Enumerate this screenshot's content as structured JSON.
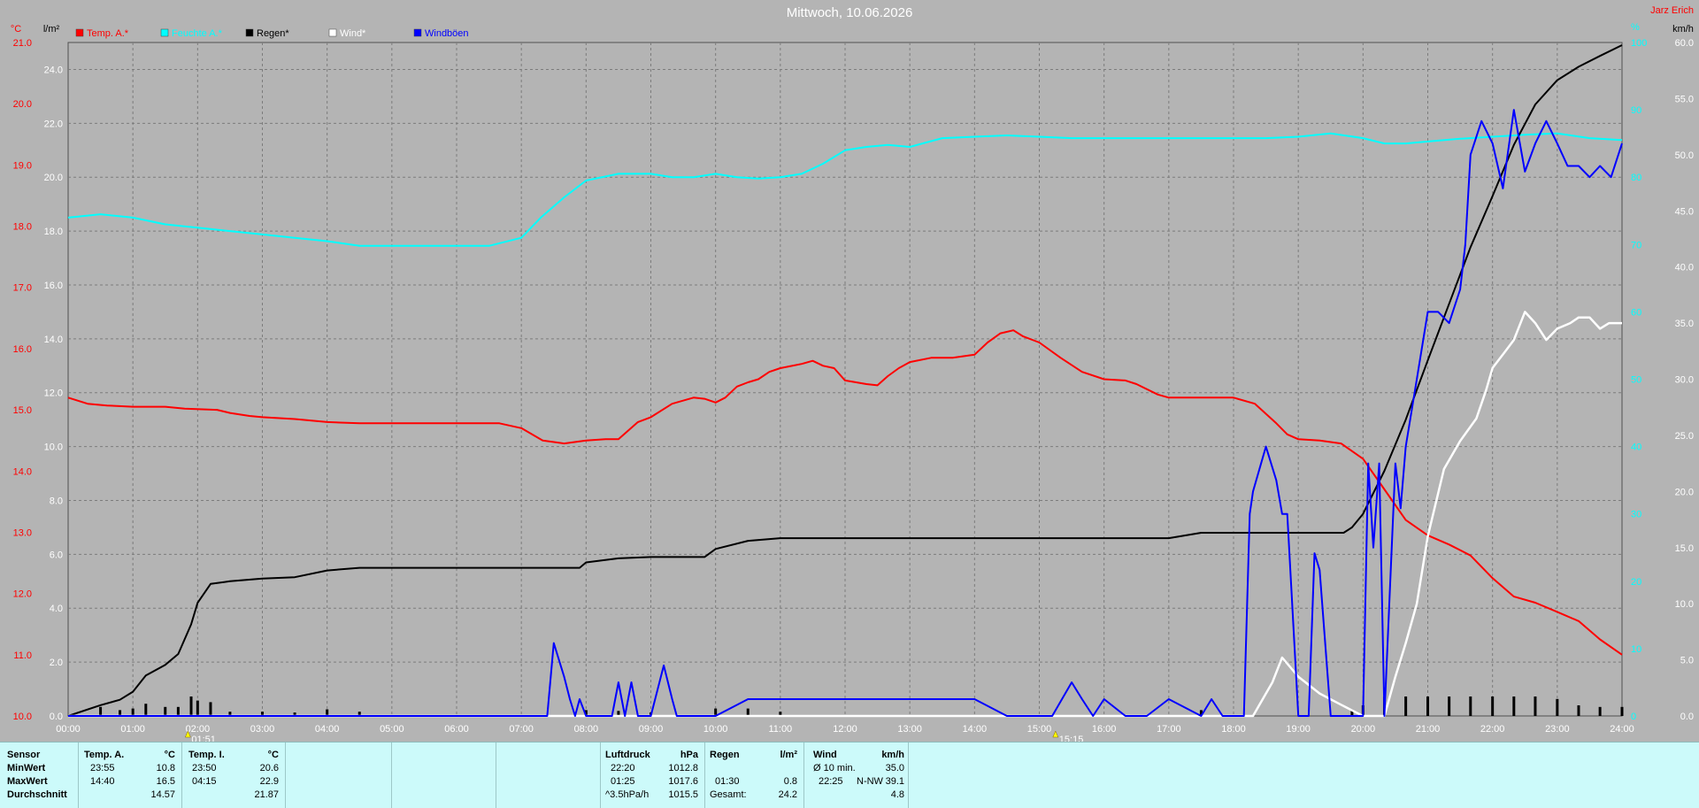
{
  "title": "Mittwoch, 10.06.2026",
  "author": "Jarz Erich",
  "units": {
    "left_outer": "°C",
    "left_inner": "l/m²",
    "right_inner": "%",
    "right_outer": "km/h"
  },
  "legend": [
    {
      "label": "Temp. A.*",
      "color": "#ff0000"
    },
    {
      "label": "Feuchte A.*",
      "color": "#00ffff"
    },
    {
      "label": "Regen*",
      "color": "#000000"
    },
    {
      "label": "Wind*",
      "color": "#ffffff"
    },
    {
      "label": "Windböen",
      "color": "#0000ff"
    }
  ],
  "markers": [
    {
      "time": "01:51",
      "hour": 1.85
    },
    {
      "time": "15:15",
      "hour": 15.25
    }
  ],
  "colors": {
    "background": "#b4b4b4",
    "grid": "#7c7c7c",
    "temp": "#ff0000",
    "humidity": "#00ffff",
    "rain": "#000000",
    "wind": "#ffffff",
    "gusts": "#0000ff",
    "table": "#ccfafa"
  },
  "chart_data": {
    "type": "line",
    "title": "Mittwoch, 10.06.2026",
    "x_ticks": [
      "00:00",
      "01:00",
      "02:00",
      "03:00",
      "04:00",
      "05:00",
      "06:00",
      "07:00",
      "08:00",
      "09:00",
      "10:00",
      "11:00",
      "12:00",
      "13:00",
      "14:00",
      "15:00",
      "16:00",
      "17:00",
      "18:00",
      "19:00",
      "20:00",
      "21:00",
      "22:00",
      "23:00",
      "24:00"
    ],
    "xlim": [
      0,
      24
    ],
    "axes": {
      "temp_c": {
        "ylim": [
          10,
          21
        ],
        "ticks": [
          "10.0",
          "11.0",
          "12.0",
          "13.0",
          "14.0",
          "15.0",
          "16.0",
          "17.0",
          "18.0",
          "19.0",
          "20.0",
          "21.0"
        ]
      },
      "rain_lm2": {
        "ylim": [
          0,
          25
        ],
        "ticks": [
          "0.0",
          "2.0",
          "4.0",
          "6.0",
          "8.0",
          "10.0",
          "12.0",
          "14.0",
          "16.0",
          "18.0",
          "20.0",
          "22.0",
          "24.0"
        ]
      },
      "humidity_pct": {
        "ylim": [
          0,
          100
        ],
        "ticks": [
          "0",
          "10",
          "20",
          "30",
          "40",
          "50",
          "60",
          "70",
          "80",
          "90",
          "100"
        ]
      },
      "wind_kmh": {
        "ylim": [
          0,
          60
        ],
        "ticks": [
          "0.0",
          "5.0",
          "10.0",
          "15.0",
          "20.0",
          "25.0",
          "30.0",
          "35.0",
          "40.0",
          "45.0",
          "50.0",
          "55.0",
          "60.0"
        ]
      }
    },
    "series": [
      {
        "name": "Temp. A.*",
        "axis": "temp_c",
        "x": [
          0,
          0.3,
          0.6,
          1.0,
          1.5,
          1.8,
          2.3,
          2.5,
          2.8,
          3.0,
          3.5,
          4.0,
          4.5,
          5.0,
          6.0,
          6.66,
          7.0,
          7.33,
          7.66,
          8.0,
          8.3,
          8.5,
          8.8,
          9.0,
          9.33,
          9.66,
          9.83,
          10.0,
          10.15,
          10.33,
          10.5,
          10.66,
          10.83,
          11.0,
          11.33,
          11.5,
          11.66,
          11.83,
          12.0,
          12.33,
          12.5,
          12.66,
          12.83,
          13.0,
          13.33,
          13.66,
          14.0,
          14.2,
          14.4,
          14.6,
          14.75,
          15.0,
          15.33,
          15.66,
          16.0,
          16.33,
          16.5,
          16.83,
          17.0,
          17.5,
          18.0,
          18.33,
          18.66,
          18.83,
          19.0,
          19.33,
          19.66,
          20.0,
          20.33,
          20.66,
          21.0,
          21.33,
          21.66,
          22.0,
          22.33,
          22.66,
          23.0,
          23.33,
          23.66,
          24.0
        ],
        "y": [
          15.2,
          15.1,
          15.07,
          15.05,
          15.05,
          15.02,
          15.0,
          14.95,
          14.9,
          14.88,
          14.85,
          14.8,
          14.78,
          14.78,
          14.78,
          14.78,
          14.7,
          14.5,
          14.45,
          14.5,
          14.52,
          14.52,
          14.8,
          14.88,
          15.1,
          15.2,
          15.18,
          15.12,
          15.2,
          15.38,
          15.45,
          15.5,
          15.62,
          15.68,
          15.75,
          15.8,
          15.72,
          15.68,
          15.48,
          15.42,
          15.4,
          15.55,
          15.68,
          15.78,
          15.85,
          15.85,
          15.9,
          16.1,
          16.25,
          16.3,
          16.2,
          16.1,
          15.85,
          15.62,
          15.5,
          15.48,
          15.42,
          15.25,
          15.2,
          15.2,
          15.2,
          15.1,
          14.78,
          14.6,
          14.52,
          14.5,
          14.45,
          14.2,
          13.7,
          13.2,
          12.95,
          12.8,
          12.62,
          12.25,
          11.95,
          11.85,
          11.7,
          11.55,
          11.25,
          11.0
        ]
      },
      {
        "name": "Feuchte A.*",
        "axis": "humidity_pct",
        "x": [
          0,
          0.5,
          1.0,
          1.5,
          2.0,
          2.5,
          3.0,
          3.5,
          4.0,
          4.5,
          5.0,
          5.5,
          6.0,
          6.5,
          7.0,
          7.3,
          7.66,
          8.0,
          8.5,
          9.0,
          9.33,
          9.66,
          10.0,
          10.33,
          10.66,
          11.0,
          11.33,
          11.66,
          12.0,
          12.33,
          12.66,
          13.0,
          13.5,
          14.0,
          14.5,
          15.0,
          15.5,
          16.0,
          16.5,
          17.0,
          17.5,
          18.0,
          18.5,
          19.0,
          19.5,
          20.0,
          20.33,
          20.66,
          21.0,
          21.5,
          22.0,
          22.5,
          23.0,
          23.5,
          24.0
        ],
        "y": [
          74,
          74.5,
          74,
          73,
          72.5,
          72,
          71.5,
          71,
          70.5,
          69.8,
          69.8,
          69.8,
          69.8,
          69.8,
          71,
          74,
          77,
          79.5,
          80.5,
          80.5,
          80,
          80,
          80.5,
          80,
          79.8,
          80,
          80.5,
          82,
          84,
          84.5,
          84.8,
          84.5,
          85.8,
          86,
          86.2,
          86,
          85.8,
          85.8,
          85.8,
          85.8,
          85.8,
          85.8,
          85.8,
          86,
          86.5,
          85.8,
          85,
          85,
          85.3,
          85.7,
          86,
          86.3,
          86.5,
          85.8,
          85.5
        ]
      },
      {
        "name": "Regen*",
        "axis": "rain_lm2",
        "x": [
          0,
          0.5,
          0.8,
          1.0,
          1.2,
          1.5,
          1.7,
          1.9,
          2.0,
          2.2,
          2.5,
          3.0,
          3.5,
          4.0,
          4.5,
          5.0,
          6.0,
          7.0,
          7.5,
          7.9,
          8.0,
          8.5,
          9.0,
          9.66,
          9.83,
          10.0,
          10.5,
          11.0,
          12.0,
          13.0,
          14.0,
          15.0,
          16.0,
          17.0,
          17.5,
          18.0,
          18.5,
          19.0,
          19.5,
          19.7,
          19.83,
          20.0,
          20.33,
          20.66,
          21.0,
          21.33,
          21.66,
          22.0,
          22.33,
          22.66,
          23.0,
          23.33,
          23.66,
          24.0
        ],
        "y": [
          0,
          0.4,
          0.6,
          0.9,
          1.5,
          1.9,
          2.3,
          3.4,
          4.2,
          4.9,
          5.0,
          5.1,
          5.15,
          5.4,
          5.5,
          5.5,
          5.5,
          5.5,
          5.5,
          5.5,
          5.7,
          5.85,
          5.9,
          5.9,
          5.9,
          6.2,
          6.5,
          6.6,
          6.6,
          6.6,
          6.6,
          6.6,
          6.6,
          6.6,
          6.8,
          6.8,
          6.8,
          6.8,
          6.8,
          6.8,
          7.0,
          7.5,
          9.1,
          11.0,
          13.2,
          15.3,
          17.4,
          19.3,
          21.2,
          22.7,
          23.6,
          24.1,
          24.5,
          24.9
        ]
      },
      {
        "name": "Wind*",
        "axis": "wind_kmh",
        "x": [
          0,
          18.0,
          18.3,
          18.6,
          18.75,
          19.0,
          19.33,
          19.66,
          19.83,
          20.0,
          20.33,
          20.5,
          20.66,
          20.83,
          21.0,
          21.25,
          21.5,
          21.75,
          21.9,
          22.0,
          22.2,
          22.33,
          22.5,
          22.66,
          22.83,
          23.0,
          23.2,
          23.33,
          23.5,
          23.66,
          23.8,
          24.0
        ],
        "y": [
          0,
          0,
          0,
          3,
          5.2,
          3.5,
          2,
          1,
          0.5,
          0,
          0,
          3.5,
          6.5,
          10,
          16,
          22,
          24.5,
          26.5,
          29,
          31,
          32.5,
          33.5,
          36,
          35,
          33.5,
          34.5,
          35,
          35.5,
          35.5,
          34.5,
          35,
          35
        ]
      },
      {
        "name": "Windböen",
        "axis": "wind_kmh",
        "x": [
          0,
          7.4,
          7.5,
          7.66,
          7.75,
          7.83,
          7.9,
          8.0,
          8.1,
          8.4,
          8.5,
          8.6,
          8.7,
          8.8,
          9.0,
          9.2,
          9.33,
          9.4,
          9.5,
          9.66,
          9.9,
          10.0,
          10.5,
          11.0,
          11.5,
          12.0,
          12.5,
          13.0,
          13.5,
          14.0,
          14.5,
          15.2,
          15.5,
          15.66,
          15.83,
          16.0,
          16.33,
          16.66,
          17.0,
          17.5,
          17.66,
          17.83,
          18.0,
          18.16,
          18.25,
          18.3,
          18.5,
          18.66,
          18.75,
          18.83,
          19.0,
          19.16,
          19.25,
          19.33,
          19.5,
          19.66,
          19.83,
          20.0,
          20.08,
          20.16,
          20.25,
          20.33,
          20.5,
          20.58,
          20.66,
          20.83,
          21.0,
          21.16,
          21.33,
          21.5,
          21.58,
          21.66,
          21.83,
          22.0,
          22.16,
          22.33,
          22.5,
          22.66,
          22.83,
          23.0,
          23.16,
          23.33,
          23.5,
          23.66,
          23.83,
          24.0
        ],
        "y": [
          0,
          0,
          6.5,
          3.5,
          1.5,
          0,
          1.5,
          0,
          0,
          0,
          3,
          0,
          3,
          0,
          0,
          4.5,
          1.5,
          0,
          0,
          0,
          0,
          0,
          1.5,
          1.5,
          1.5,
          1.5,
          1.5,
          1.5,
          1.5,
          1.5,
          0,
          0,
          3,
          1.5,
          0,
          1.5,
          0,
          0,
          1.5,
          0,
          1.5,
          0,
          0,
          0,
          18,
          20,
          24,
          21,
          18,
          18,
          0,
          0,
          14.5,
          13,
          0,
          0,
          0,
          0,
          22.5,
          15,
          22.5,
          0,
          22.5,
          18.5,
          24,
          30,
          36,
          36,
          35,
          38,
          42,
          50,
          53,
          51,
          47,
          54,
          48.5,
          51,
          53,
          51,
          49,
          49,
          48,
          49,
          48,
          51
        ]
      }
    ],
    "bars": {
      "name": "Regen (Intervall)",
      "axis": "rain_lm2",
      "unit": "l/m²"
    }
  },
  "table": {
    "row_labels": [
      "Sensor",
      "MinWert",
      "MaxWert",
      "Durchschnitt"
    ],
    "temp_a": {
      "header": "Temp. A.",
      "unit": "°C",
      "min_time": "23:55",
      "min": "10.8",
      "max_time": "14:40",
      "max": "16.5",
      "avg": "14.57"
    },
    "temp_i": {
      "header": "Temp. I.",
      "unit": "°C",
      "min_time": "23:50",
      "min": "20.6",
      "max_time": "04:15",
      "max": "22.9",
      "avg": "21.87"
    },
    "pressure": {
      "header": "Luftdruck",
      "unit": "hPa",
      "min_time": "22:20",
      "min": "1012.8",
      "max_time": "01:25",
      "max": "1017.6",
      "trend_label": "^3.5hPa/h",
      "trend_value": "1015.5"
    },
    "rain": {
      "header": "Regen",
      "unit": "l/m²",
      "max_time": "01:30",
      "max": "0.8",
      "total_label": "Gesamt:",
      "total": "24.2"
    },
    "wind": {
      "header": "Wind",
      "unit": "km/h",
      "avg10_label": "Ø 10 min.",
      "avg10": "35.0",
      "max_time": "22:25",
      "max_dir": "N-NW",
      "max": "39.1",
      "avg": "4.8"
    }
  }
}
